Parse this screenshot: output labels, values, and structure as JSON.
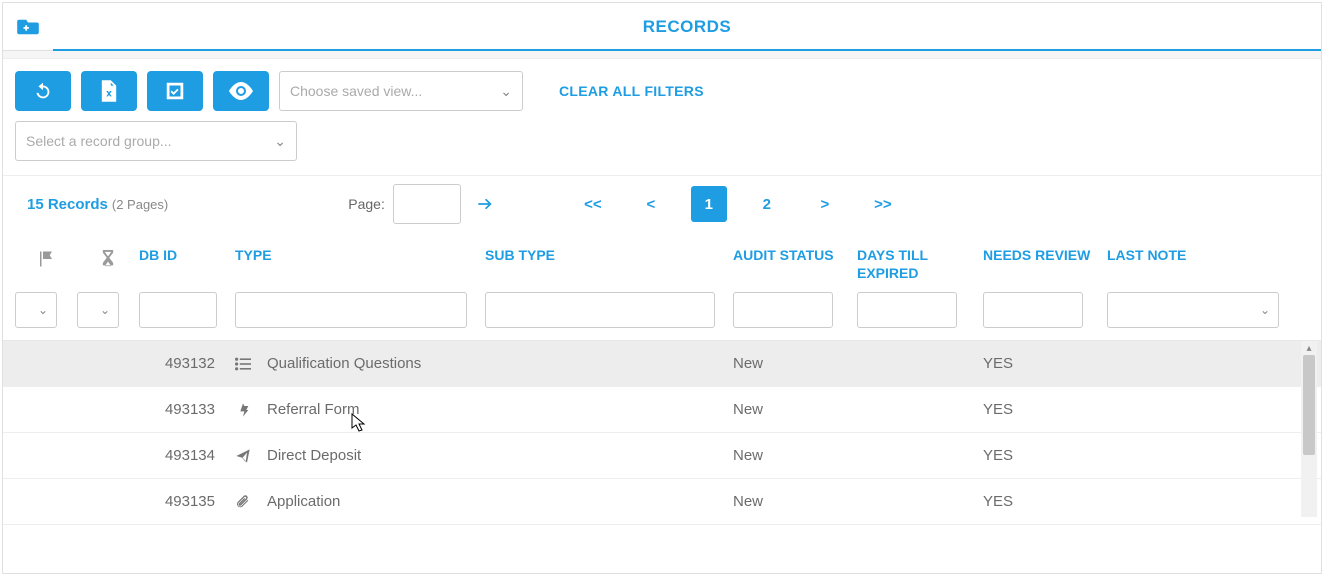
{
  "tabs": {
    "records_label": "RECORDS"
  },
  "toolbar": {
    "saved_view_placeholder": "Choose saved view...",
    "clear_filters_label": "CLEAR ALL FILTERS",
    "record_group_placeholder": "Select a record group..."
  },
  "results": {
    "count_label": "15 Records",
    "pages_label": "(2 Pages)",
    "page_label": "Page:",
    "page_value": ""
  },
  "pager": {
    "first": "<<",
    "prev": "<",
    "p1": "1",
    "p2": "2",
    "next": ">",
    "last": ">>"
  },
  "columns": {
    "dbid": "DB ID",
    "type": "TYPE",
    "sub": "SUB TYPE",
    "audit": "AUDIT STATUS",
    "days": "DAYS TILL EXPIRED",
    "need": "NEEDS REVIEW",
    "last": "LAST NOTE"
  },
  "rows": [
    {
      "dbid": "493132",
      "icon": "list",
      "type": "Qualification Questions",
      "sub": "",
      "audit": "New",
      "days": "",
      "need": "YES",
      "last": ""
    },
    {
      "dbid": "493133",
      "icon": "referral",
      "type": "Referral Form",
      "sub": "",
      "audit": "New",
      "days": "",
      "need": "YES",
      "last": ""
    },
    {
      "dbid": "493134",
      "icon": "send",
      "type": "Direct Deposit",
      "sub": "",
      "audit": "New",
      "days": "",
      "need": "YES",
      "last": ""
    },
    {
      "dbid": "493135",
      "icon": "clip",
      "type": "Application",
      "sub": "",
      "audit": "New",
      "days": "",
      "need": "YES",
      "last": ""
    }
  ]
}
